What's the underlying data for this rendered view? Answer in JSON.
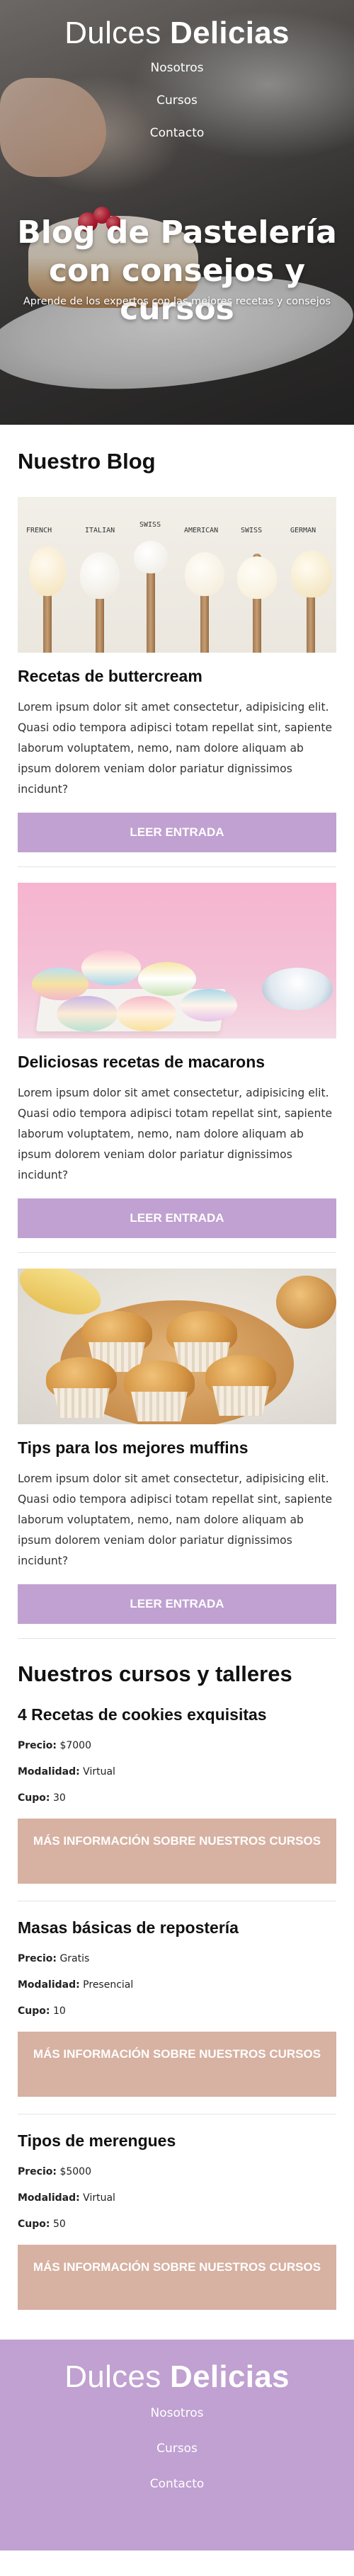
{
  "header": {
    "logo_light": "Dulces",
    "logo_bold": "Delicias",
    "nav": [
      "Nosotros",
      "Cursos",
      "Contacto"
    ],
    "title": "Blog de Pastelería con consejos y cursos",
    "subtitle": "Aprende de los expertos con las mejores recetas y consejos"
  },
  "blog": {
    "title": "Nuestro Blog",
    "button_label": "LEER ENTRADA",
    "entries": [
      {
        "title": "Recetas de buttercream",
        "text": "Lorem ipsum dolor sit amet consectetur, adipisicing elit. Quasi odio tempora adipisci totam repellat sint, sapiente laborum voluptatem, nemo, nam dolore aliquam ab ipsum dolorem veniam dolor pariatur dignissimos incidunt?",
        "image_labels": [
          "FRENCH",
          "ITALIAN",
          "SWISS",
          "AMERICAN",
          "SWISS",
          "GERMAN"
        ]
      },
      {
        "title": "Deliciosas recetas de macarons",
        "text": "Lorem ipsum dolor sit amet consectetur, adipisicing elit. Quasi odio tempora adipisci totam repellat sint, sapiente laborum voluptatem, nemo, nam dolore aliquam ab ipsum dolorem veniam dolor pariatur dignissimos incidunt?"
      },
      {
        "title": "Tips para los mejores muffins",
        "text": "Lorem ipsum dolor sit amet consectetur, adipisicing elit. Quasi odio tempora adipisci totam repellat sint, sapiente laborum voluptatem, nemo, nam dolore aliquam ab ipsum dolorem veniam dolor pariatur dignissimos incidunt?"
      }
    ]
  },
  "courses": {
    "title": "Nuestros cursos y talleres",
    "price_label": "Precio:",
    "mode_label": "Modalidad:",
    "seats_label": "Cupo:",
    "button_label": "MÁS INFORMACIÓN SOBRE NUESTROS CURSOS",
    "items": [
      {
        "title": "4 Recetas de cookies exquisitas",
        "price": "$7000",
        "mode": "Virtual",
        "seats": "30"
      },
      {
        "title": "Masas básicas de repostería",
        "price": "Gratis",
        "mode": "Presencial",
        "seats": "10"
      },
      {
        "title": "Tipos de merengues",
        "price": "$5000",
        "mode": "Virtual",
        "seats": "50"
      }
    ]
  },
  "footer": {
    "logo_light": "Dulces",
    "logo_bold": "Delicias",
    "nav": [
      "Nosotros",
      "Cursos",
      "Contacto"
    ]
  },
  "colors": {
    "accent_purple": "#c0a1d1",
    "accent_peach": "#d7b1a1"
  }
}
